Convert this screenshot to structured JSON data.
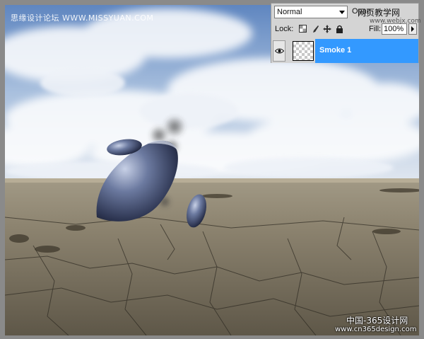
{
  "watermarks": {
    "top_left": "思缘设计论坛 WWW.MISSYUAN.COM",
    "top_right": "网页教学网",
    "top_right_sub": "www.webjx.com",
    "bottom_line1": "中国-365设计网",
    "bottom_line2": "www.cn365design.com"
  },
  "layers_panel": {
    "blend_mode": "Normal",
    "opacity_label": "Opac",
    "lock_label": "Lock:",
    "lock_icons": [
      "lock-transparent-icon",
      "lock-brush-icon",
      "lock-move-icon",
      "lock-all-icon"
    ],
    "fill_label": "Fill:",
    "fill_value": "100%",
    "layer": {
      "name": "Smoke 1",
      "visible_icon": "eye-icon"
    },
    "accent_color": "#3399ff"
  }
}
